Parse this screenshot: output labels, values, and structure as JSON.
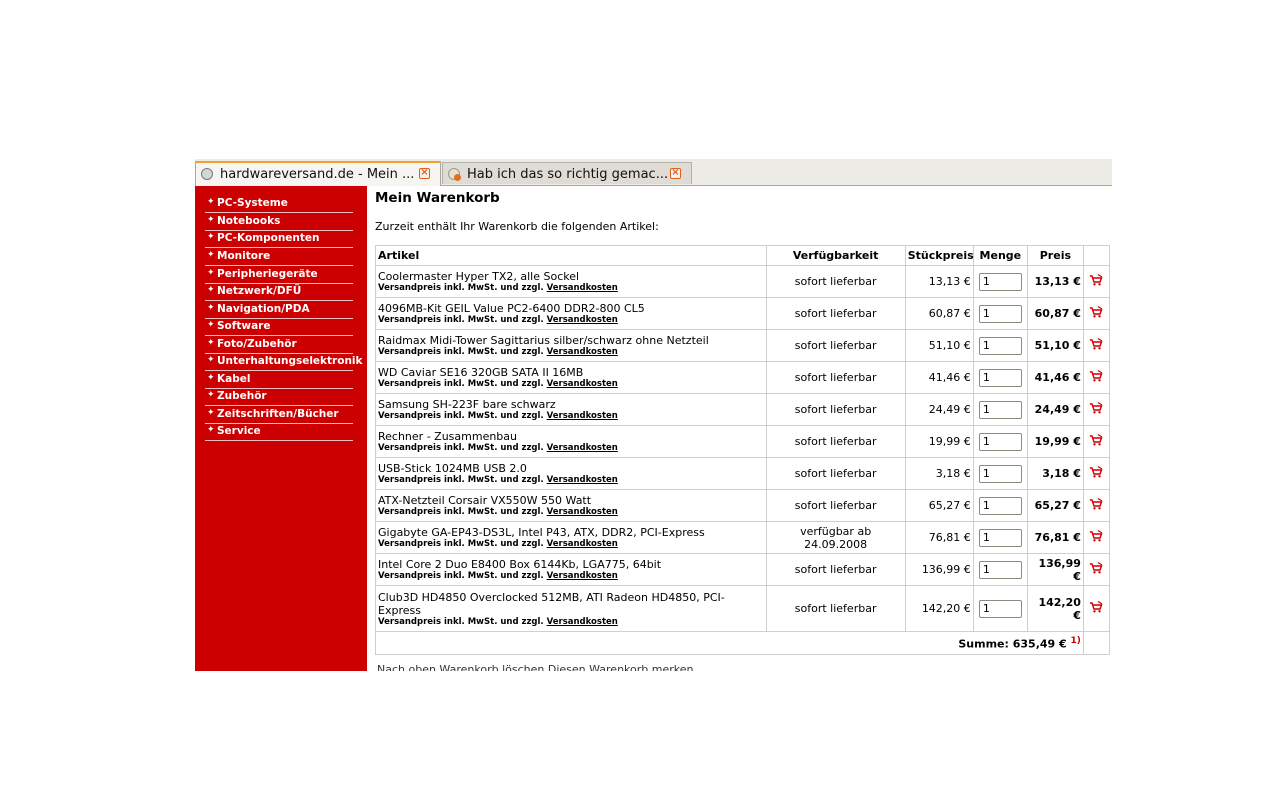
{
  "tabs": [
    {
      "title": "hardwareversand.de - Mein ...",
      "active": true
    },
    {
      "title": "Hab ich das so richtig gemac...",
      "active": false
    }
  ],
  "sidebar": {
    "items": [
      {
        "label": "PC-Systeme"
      },
      {
        "label": "Notebooks"
      },
      {
        "label": "PC-Komponenten"
      },
      {
        "label": "Monitore"
      },
      {
        "label": "Peripheriegeräte"
      },
      {
        "label": "Netzwerk/DFÜ"
      },
      {
        "label": "Navigation/PDA"
      },
      {
        "label": "Software"
      },
      {
        "label": "Foto/Zubehör"
      },
      {
        "label": "Unterhaltungselektronik"
      },
      {
        "label": "Kabel"
      },
      {
        "label": "Zubehör"
      },
      {
        "label": "Zeitschriften/Bücher"
      },
      {
        "label": "Service"
      }
    ]
  },
  "main": {
    "title": "Mein Warenkorb",
    "intro": "Zurzeit enthält Ihr Warenkorb die folgenden Artikel:",
    "columns": {
      "artikel": "Artikel",
      "verfuegbarkeit": "Verfügbarkeit",
      "stueckpreis": "Stückpreis",
      "menge": "Menge",
      "preis": "Preis"
    },
    "subtext": "Versandpreis inkl. MwSt. und zzgl.",
    "subtext_link": "Versandkosten",
    "items": [
      {
        "name": "Coolermaster Hyper TX2, alle Sockel",
        "availability": "sofort lieferbar",
        "unit_price": "13,13 €",
        "qty": "1",
        "price": "13,13 €"
      },
      {
        "name": "4096MB-Kit GEIL Value PC2-6400 DDR2-800 CL5",
        "availability": "sofort lieferbar",
        "unit_price": "60,87 €",
        "qty": "1",
        "price": "60,87 €"
      },
      {
        "name": "Raidmax Midi-Tower Sagittarius silber/schwarz ohne Netzteil",
        "availability": "sofort lieferbar",
        "unit_price": "51,10 €",
        "qty": "1",
        "price": "51,10 €"
      },
      {
        "name": "WD Caviar SE16 320GB SATA II 16MB",
        "availability": "sofort lieferbar",
        "unit_price": "41,46 €",
        "qty": "1",
        "price": "41,46 €"
      },
      {
        "name": "Samsung SH-223F bare schwarz",
        "availability": "sofort lieferbar",
        "unit_price": "24,49 €",
        "qty": "1",
        "price": "24,49 €"
      },
      {
        "name": "Rechner - Zusammenbau",
        "availability": "sofort lieferbar",
        "unit_price": "19,99 €",
        "qty": "1",
        "price": "19,99 €"
      },
      {
        "name": "USB-Stick 1024MB USB 2.0",
        "availability": "sofort lieferbar",
        "unit_price": "3,18 €",
        "qty": "1",
        "price": "3,18 €"
      },
      {
        "name": "ATX-Netzteil Corsair VX550W 550 Watt",
        "availability": "sofort lieferbar",
        "unit_price": "65,27 €",
        "qty": "1",
        "price": "65,27 €"
      },
      {
        "name": "Gigabyte GA-EP43-DS3L, Intel P43, ATX, DDR2, PCI-Express",
        "availability": "verfügbar ab 24.09.2008",
        "unit_price": "76,81 €",
        "qty": "1",
        "price": "76,81 €"
      },
      {
        "name": "Intel Core 2 Duo E8400 Box 6144Kb, LGA775, 64bit",
        "availability": "sofort lieferbar",
        "unit_price": "136,99 €",
        "qty": "1",
        "price": "136,99 €"
      },
      {
        "name": "Club3D HD4850 Overclocked 512MB, ATI Radeon HD4850, PCI-Express",
        "availability": "sofort lieferbar",
        "unit_price": "142,20 €",
        "qty": "1",
        "price": "142,20 €"
      }
    ],
    "sum_label": "Summe: 635,49 €",
    "sum_footnote": "1)",
    "bottom_text": "Nach oben    Warenkorb löschen    Diesen Warenkorb merken"
  },
  "colors": {
    "brand_red": "#cc0000",
    "active_tab_accent": "#f0a030"
  },
  "icons": {
    "tab_close": "close-icon",
    "remove_item": "cart-remove-icon",
    "bullet": "diamond-bullet-icon"
  }
}
